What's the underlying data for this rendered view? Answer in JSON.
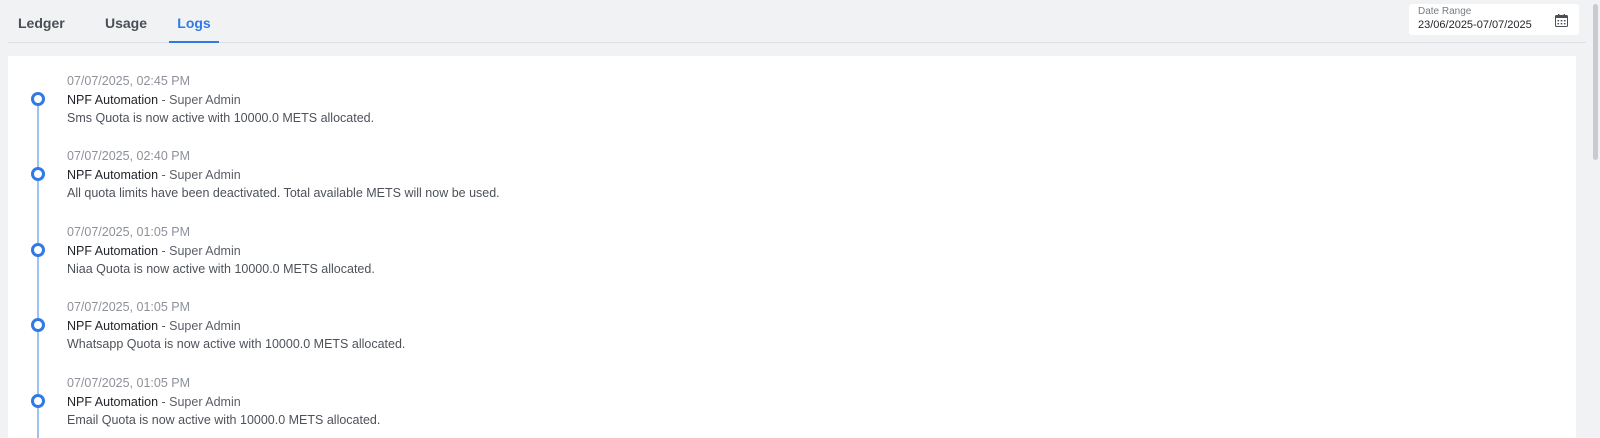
{
  "tabs": [
    {
      "label": "Ledger"
    },
    {
      "label": "Usage"
    },
    {
      "label": "Logs",
      "active": true
    }
  ],
  "date_range": {
    "label": "Date Range",
    "value": "23/06/2025-07/07/2025",
    "icon": "calendar-icon"
  },
  "colors": {
    "accent": "#2f7ae5",
    "timeline_line": "#9cc2f4"
  },
  "logs": [
    {
      "timestamp": "07/07/2025, 02:45 PM",
      "actor": "NPF Automation",
      "role": " - Super Admin",
      "message": "Sms Quota is now active with 10000.0 METS allocated."
    },
    {
      "timestamp": "07/07/2025, 02:40 PM",
      "actor": "NPF Automation",
      "role": " - Super Admin",
      "message": "All quota limits have been deactivated. Total available METS will now be used."
    },
    {
      "timestamp": "07/07/2025, 01:05 PM",
      "actor": "NPF Automation",
      "role": " - Super Admin",
      "message": "Niaa Quota is now active with 10000.0 METS allocated."
    },
    {
      "timestamp": "07/07/2025, 01:05 PM",
      "actor": "NPF Automation",
      "role": " - Super Admin",
      "message": "Whatsapp Quota is now active with 10000.0 METS allocated."
    },
    {
      "timestamp": "07/07/2025, 01:05 PM",
      "actor": "NPF Automation",
      "role": " - Super Admin",
      "message": "Email Quota is now active with 10000.0 METS allocated."
    }
  ]
}
